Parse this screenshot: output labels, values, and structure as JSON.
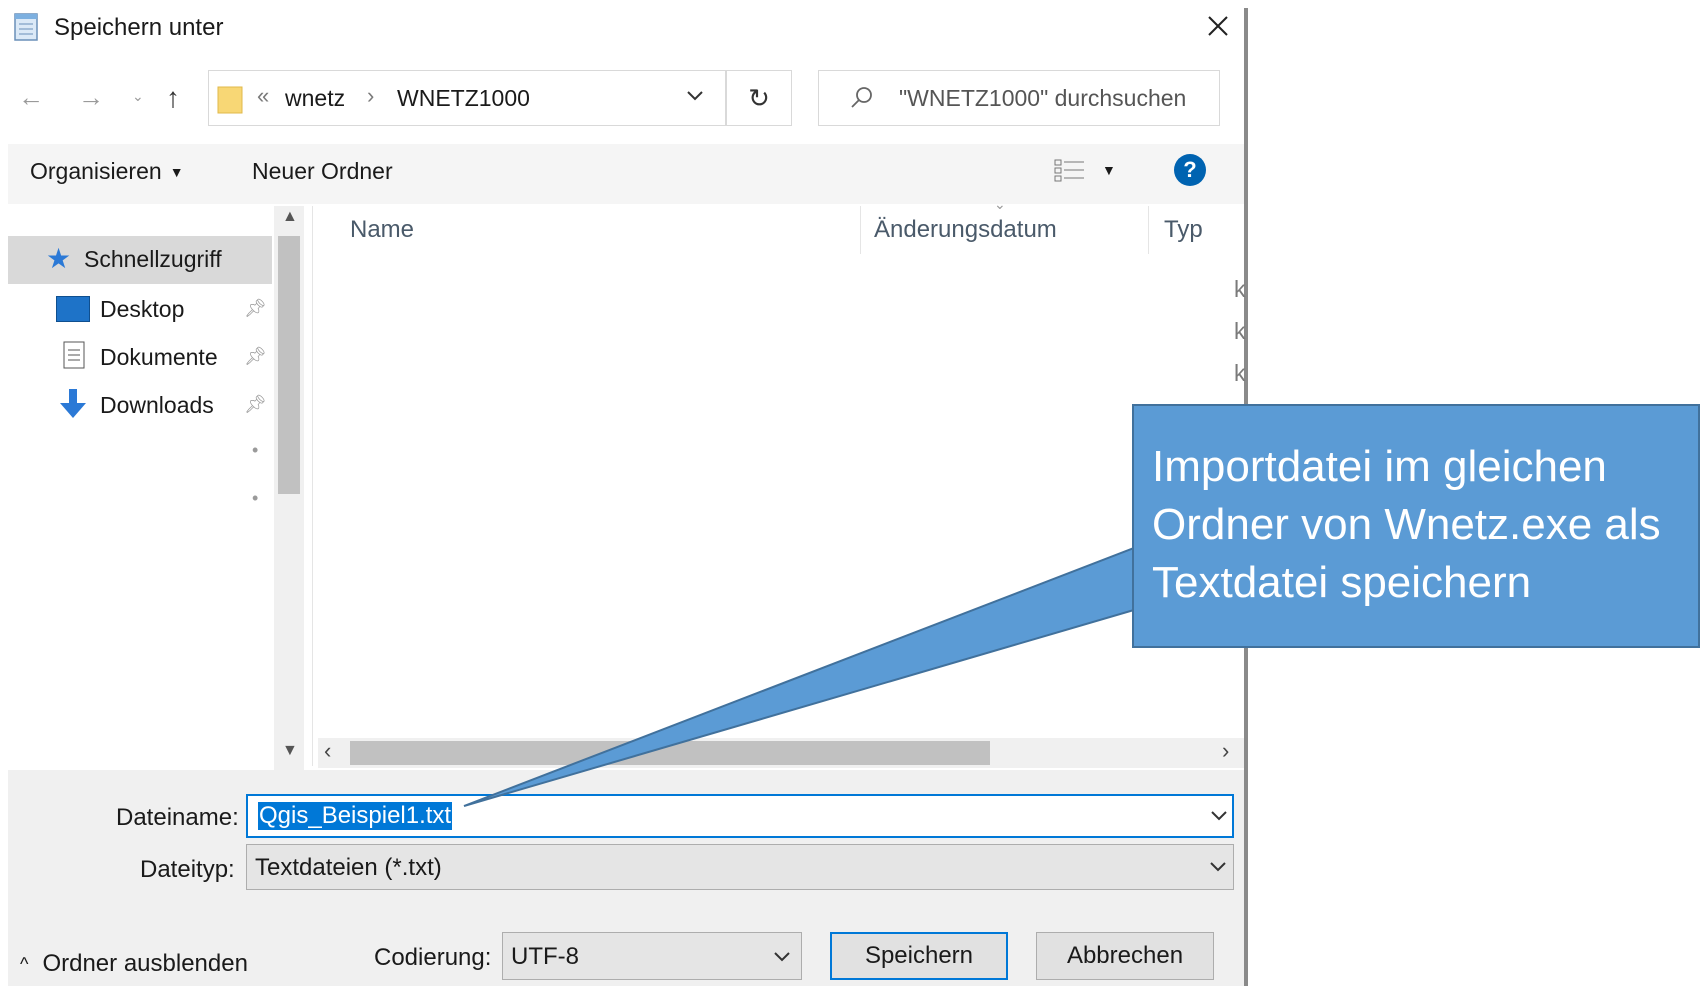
{
  "window": {
    "title": "Speichern unter"
  },
  "nav": {
    "path": [
      "wnetz",
      "WNETZ1000"
    ],
    "path_prefix": "«",
    "path_sep": "›",
    "search_placeholder": "\"WNETZ1000\" durchsuchen"
  },
  "toolbar": {
    "organize": "Organisieren",
    "new_folder": "Neuer Ordner"
  },
  "sidebar": {
    "items": [
      {
        "label": "Schnellzugriff",
        "icon": "star-icon"
      },
      {
        "label": "Desktop",
        "icon": "desktop-icon"
      },
      {
        "label": "Dokumente",
        "icon": "document-icon"
      },
      {
        "label": "Downloads",
        "icon": "download-icon"
      }
    ]
  },
  "columns": {
    "name": "Name",
    "date": "Änderungsdatum",
    "type": "Typ"
  },
  "clipped_type_cells": [
    "k",
    "k",
    "k"
  ],
  "form": {
    "filename_label": "Dateiname:",
    "filename_value": "Qgis_Beispiel1.txt",
    "filetype_label": "Dateityp:",
    "filetype_value": "Textdateien (*.txt)",
    "encoding_label": "Codierung:",
    "encoding_value": "UTF-8"
  },
  "footer": {
    "hide_folders": "Ordner ausblenden"
  },
  "buttons": {
    "save": "Speichern",
    "cancel": "Abbrechen"
  },
  "callout": {
    "text": "Importdatei im gleichen Ordner von Wnetz.exe als Textdatei speichern"
  },
  "colors": {
    "callout_fill": "#5b9bd5",
    "callout_border": "#41719c",
    "selection": "#0078d7",
    "help": "#0063b1"
  }
}
